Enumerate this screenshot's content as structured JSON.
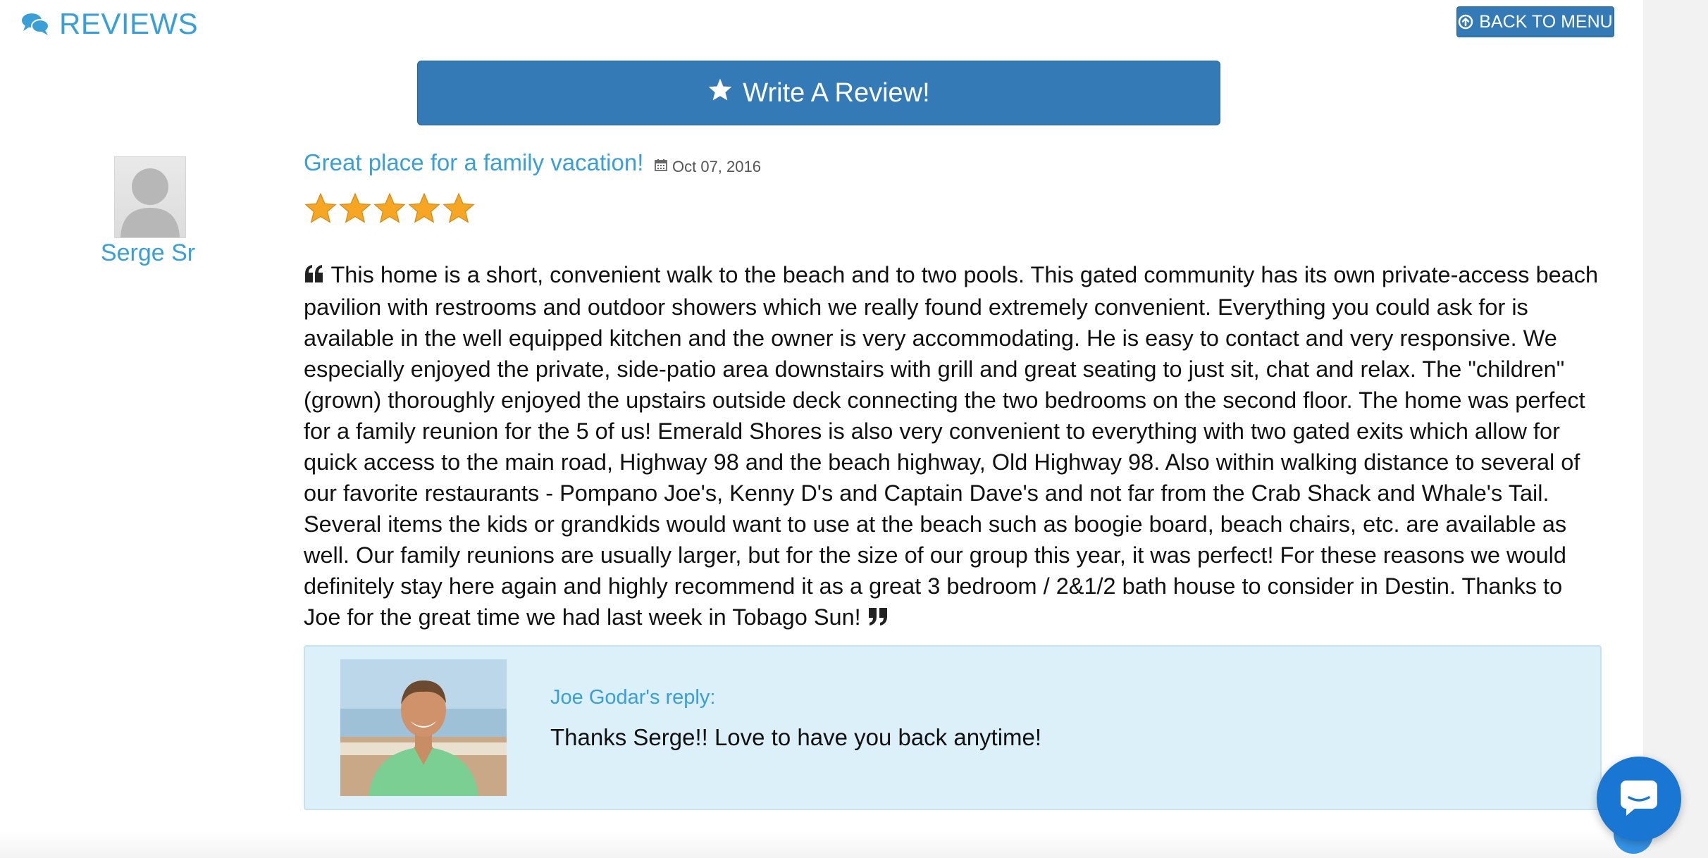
{
  "header": {
    "title": "REVIEWS",
    "back_button_label": "BACK TO MENU"
  },
  "write_review": {
    "label": "Write A Review!"
  },
  "review": {
    "reviewer_name": "Serge Sr",
    "title": "Great place for a family vacation!",
    "date": "Oct 07, 2016",
    "rating": 5,
    "rating_max": 5,
    "text": "This home is a short, convenient walk to the beach and to two pools. This gated community has its own private-access beach pavilion with restrooms and outdoor showers which we really found extremely convenient. Everything you could ask for is available in the well equipped kitchen and the owner is very accommodating. He is easy to contact and very responsive. We especially enjoyed the private, side-patio area downstairs with grill and great seating to just sit, chat and relax. The \"children\" (grown) thoroughly enjoyed the upstairs outside deck connecting the two bedrooms on the second floor. The home was perfect for a family reunion for the 5 of us! Emerald Shores is also very convenient to everything with two gated exits which allow for quick access to the main road, Highway 98 and the beach highway, Old Highway 98. Also within walking distance to several of our favorite restaurants - Pompano Joe's, Kenny D's and Captain Dave's and not far from the Crab Shack and Whale's Tail. Several items the kids or grandkids would want to use at the beach such as boogie board, beach chairs, etc. are available as well. Our family reunions are usually larger, but for the size of our group this year, it was perfect! For these reasons we would definitely stay here again and highly recommend it as a great 3 bedroom / 2&1/2 bath house to consider in Destin. Thanks to Joe for the great time we had last week in Tobago Sun!",
    "reply": {
      "author": "Joe Godar's reply:",
      "text": "Thanks Serge!! Love to have you back anytime!"
    }
  },
  "icons": {
    "reviews": "comments-icon",
    "back": "circle-arrow-up-icon",
    "write": "star-icon",
    "date": "calendar-icon",
    "quote_open": "quote-left-icon",
    "quote_close": "quote-right-icon",
    "chat": "chat-icon"
  },
  "colors": {
    "accent": "#3a9fd6",
    "button": "#337ab7",
    "reply_bg": "#dcf0fa",
    "star": "#f6a623",
    "chat": "#1976d2"
  }
}
